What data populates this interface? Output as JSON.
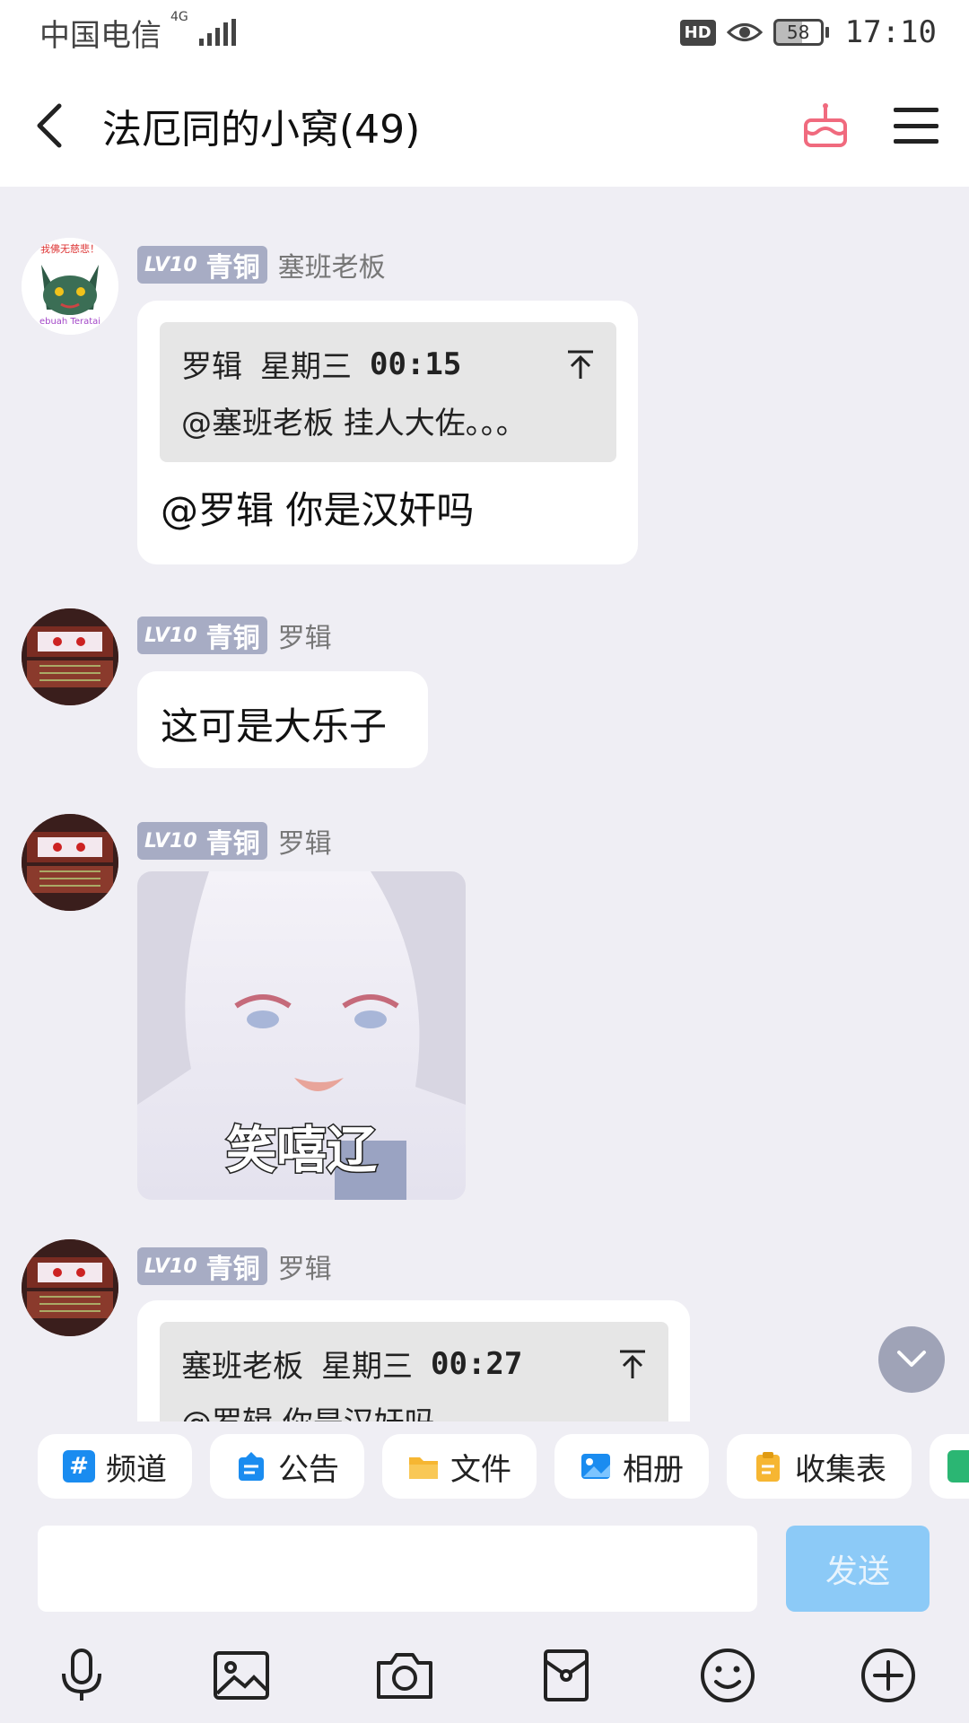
{
  "status_bar": {
    "carrier": "中国电信",
    "network": "4G",
    "hd": "HD",
    "battery": "58",
    "time": "17:10"
  },
  "header": {
    "title": "法厄同的小窝(49)"
  },
  "messages": [
    {
      "badge_lv": "LV10",
      "badge_rank": "青铜",
      "sender": "塞班老板",
      "quote": {
        "author": "罗辑",
        "day": "星期三",
        "time": "00:15",
        "text": "@塞班老板 挂人大佐。。。"
      },
      "text": "@罗辑 你是汉奸吗"
    },
    {
      "badge_lv": "LV10",
      "badge_rank": "青铜",
      "sender": "罗辑",
      "text": "这可是大乐子"
    },
    {
      "badge_lv": "LV10",
      "badge_rank": "青铜",
      "sender": "罗辑",
      "sticker_caption": "笑嘻辽"
    },
    {
      "badge_lv": "LV10",
      "badge_rank": "青铜",
      "sender": "罗辑",
      "quote": {
        "author": "塞班老板",
        "day": "星期三",
        "time": "00:27",
        "text": "@罗辑 你是汉奸吗"
      }
    }
  ],
  "avatar_texts": {
    "cat_top": "我佛无慈悲！",
    "cat_bottom": "ebuah Teratai"
  },
  "toolbar": {
    "chips": [
      {
        "label": "频道",
        "icon": "hash-icon",
        "color": "#1a8cf0"
      },
      {
        "label": "公告",
        "icon": "announcement-icon",
        "color": "#1a8cf0"
      },
      {
        "label": "文件",
        "icon": "folder-icon",
        "color": "#f6b632"
      },
      {
        "label": "相册",
        "icon": "album-icon",
        "color": "#1a8cf0"
      },
      {
        "label": "收集表",
        "icon": "clipboard-icon",
        "color": "#f6b632"
      }
    ]
  },
  "input": {
    "placeholder": "",
    "send_label": "发送"
  },
  "colors": {
    "badge": "#a7acc4",
    "send_disabled": "#8ccaf7",
    "chat_bg": "#efeef4"
  }
}
